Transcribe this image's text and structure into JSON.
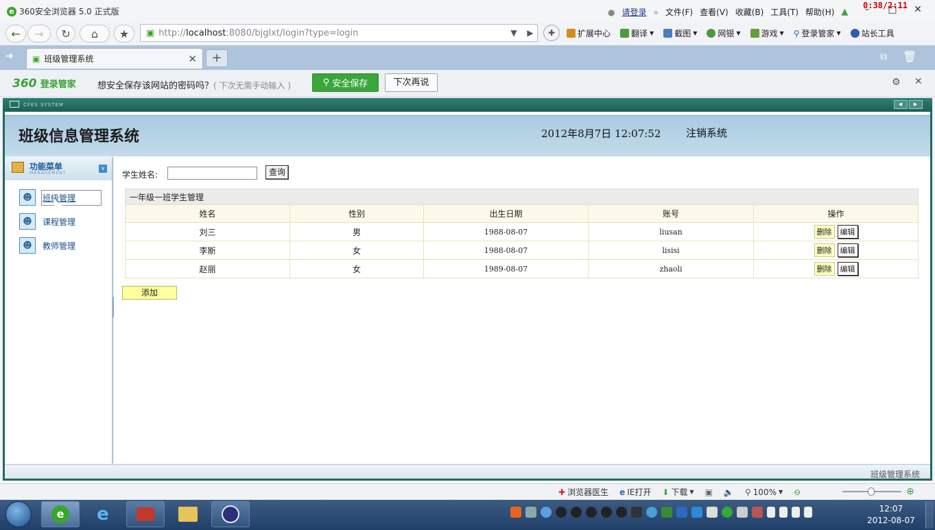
{
  "browser": {
    "app_title": "360安全浏览器 5.0 正式版",
    "top_menu": [
      "请登录",
      "文件(F)",
      "查看(V)",
      "收藏(B)",
      "工具(T)",
      "帮助(H)"
    ],
    "timer": "0:38/2:11",
    "url_prefix": "http://",
    "url_host": "localhost",
    "url_rest": ":8080/bjglxt/login?type=login",
    "toolbar_links": [
      "扩展中心",
      "翻译",
      "截图",
      "网银",
      "游戏",
      "登录管家",
      "站长工具"
    ],
    "tab_title": "班级管理系统",
    "password_bar": {
      "brand": "360",
      "brand_suffix": "登录管家",
      "message": "想安全保存该网站的密码吗？",
      "hint": "( 下次无需手动输入 )",
      "save_label": "安全保存",
      "later_label": "下次再说"
    },
    "status_items": [
      "浏览器医生",
      "IE打开",
      "下载",
      "100%"
    ]
  },
  "app": {
    "frame_label": "CFES SYSTEM",
    "title": "班级信息管理系统",
    "datetime": "2012年8月7日  12:07:52",
    "logout": "注销系统",
    "footer": "班级管理系统",
    "menu": {
      "title": "功能菜单",
      "subtitle": "MANAGEMENT",
      "items": [
        "班级管理",
        "课程管理",
        "教师管理"
      ],
      "selected_index": 0
    },
    "search": {
      "label": "学生姓名:",
      "value": "",
      "query_label": "查询"
    },
    "table": {
      "caption": "一年级一班学生管理",
      "columns": [
        "姓名",
        "性别",
        "出生日期",
        "账号",
        "操作"
      ],
      "rows": [
        {
          "name": "刘三",
          "gender": "男",
          "birth": "1988-08-07",
          "account": "liusan"
        },
        {
          "name": "李斯",
          "gender": "女",
          "birth": "1988-08-07",
          "account": "lisisi"
        },
        {
          "name": "赵丽",
          "gender": "女",
          "birth": "1989-08-07",
          "account": "zhaoli"
        }
      ],
      "delete_label": "删除",
      "edit_label": "编辑"
    },
    "add_label": "添加"
  },
  "taskbar": {
    "clock_time": "12:07",
    "clock_date": "2012-08-07"
  },
  "colors": {
    "accent_green": "#3aa63b",
    "frame_teal": "#24685d",
    "header_blue": "#a9cbe1",
    "link_blue": "#184e8c"
  }
}
